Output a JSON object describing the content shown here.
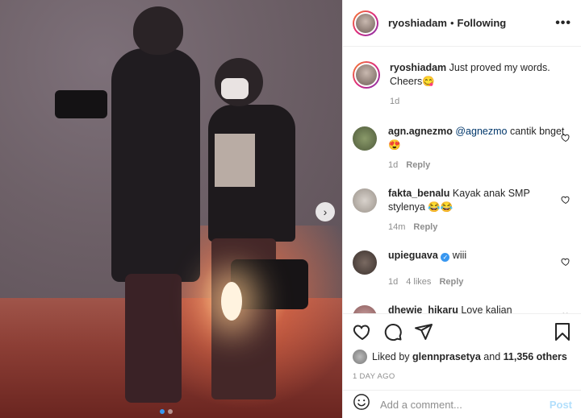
{
  "post_header": {
    "username": "ryoshiadam",
    "separator": "•",
    "follow_status": "Following",
    "more": "•••"
  },
  "caption": {
    "username": "ryoshiadam",
    "text": "Just proved my words. Cheers😋",
    "time": "1d"
  },
  "comments": [
    {
      "username": "agn.agnezmo",
      "mention": "@agnezmo",
      "text": " cantik bnget😍",
      "time": "1d",
      "likes": "",
      "reply": "Reply"
    },
    {
      "username": "fakta_benalu",
      "mention": "",
      "text": "Kayak anak SMP stylenya 😂😂",
      "time": "14m",
      "likes": "",
      "reply": "Reply"
    },
    {
      "username": "upieguava",
      "mention": "",
      "text": "wiii",
      "time": "1d",
      "likes": "4 likes",
      "reply": "Reply"
    },
    {
      "username": "dhewie_hikaru",
      "mention": "",
      "text": "Love kalian",
      "time": "",
      "likes": "",
      "reply": ""
    }
  ],
  "likes": {
    "prefix": "Liked by",
    "user": "glennprasetya",
    "and": "and",
    "others": "11,356 others"
  },
  "posted_ago": "1 DAY AGO",
  "add_comment": {
    "placeholder": "Add a comment...",
    "post_label": "Post"
  },
  "carousel": {
    "next_arrow": "›",
    "dots_total": 2,
    "active_dot": 1
  },
  "colors": {
    "text": "#262626",
    "muted": "#8e8e8e",
    "link": "#00376b",
    "accent_blue": "#3897f0",
    "post_disabled": "#b2dffc"
  },
  "icons": [
    "heart-icon",
    "comment-icon",
    "share-icon",
    "bookmark-icon",
    "emoji-icon",
    "verified-icon",
    "more-icon",
    "chevron-right-icon"
  ]
}
